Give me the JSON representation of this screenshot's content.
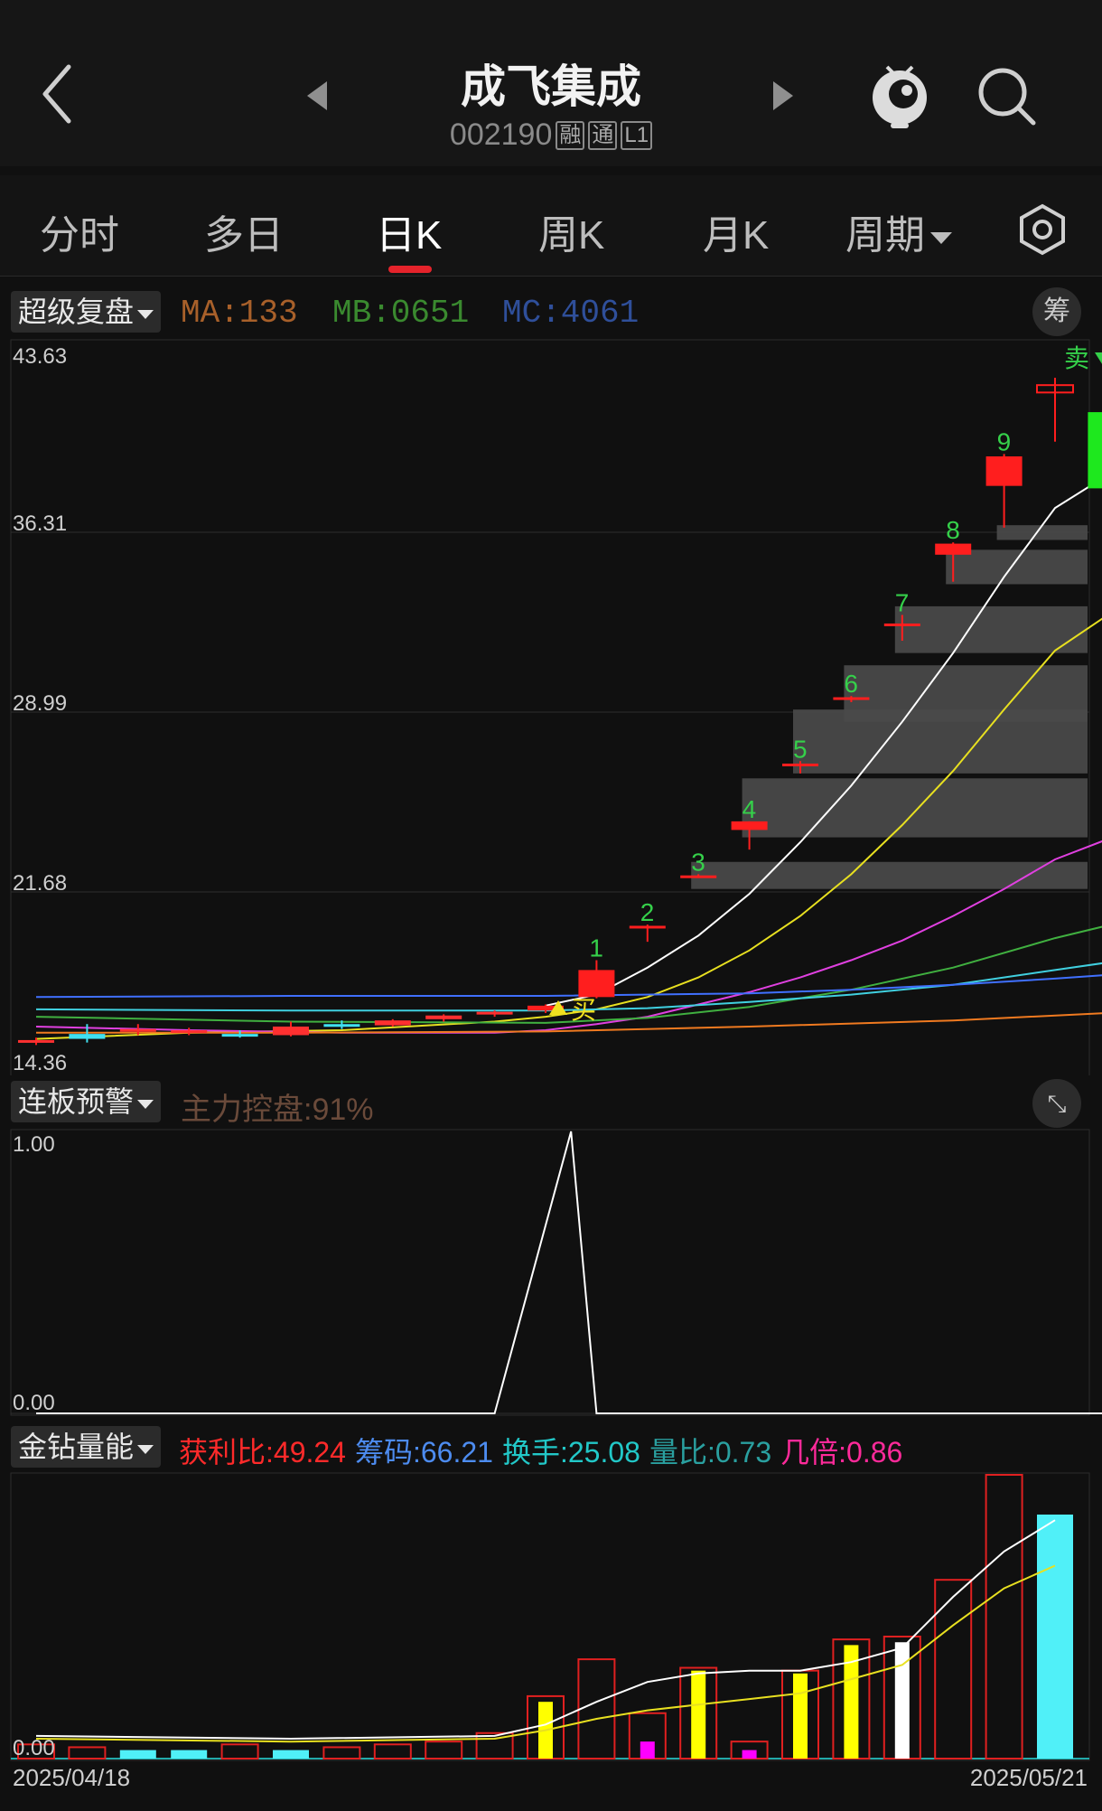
{
  "header": {
    "stock_name": "成飞集成",
    "stock_code": "002190",
    "tag_rong": "融",
    "tag_tong": "通",
    "tag_level": "L1"
  },
  "tabs": [
    "分时",
    "多日",
    "日K",
    "周K",
    "月K",
    "周期"
  ],
  "active_tab": "日K",
  "main_panel": {
    "button": "超级复盘",
    "ma_label": "MA:133",
    "mb_label": "MB:0651",
    "mc_label": "MC:4061",
    "chip_button": "筹",
    "colors": {
      "ma": "#a8602a",
      "mb": "#3a8a2f",
      "mc": "#2f4f9a"
    }
  },
  "lianban_panel": {
    "button": "连板预警",
    "indicator": "主力控盘:91%",
    "y_top": "1.00",
    "y_bottom": "0.00"
  },
  "volume_panel": {
    "button": "金钻量能",
    "stats": [
      {
        "text": "获利比:49.24",
        "color": "#ff2a2a"
      },
      {
        "text": "筹码:66.21",
        "color": "#4d8cf0"
      },
      {
        "text": "换手:25.08",
        "color": "#22c8c8"
      },
      {
        "text": "量比:0.73",
        "color": "#2aa0a0"
      },
      {
        "text": "几倍:0.86",
        "color": "#ff2a9a"
      }
    ],
    "y_bottom": "0.00"
  },
  "chart_data": {
    "type": "candlestick",
    "y_ticks": [
      "43.63",
      "36.31",
      "28.99",
      "21.68",
      "14.36"
    ],
    "ylim": [
      14.36,
      43.63
    ],
    "x_start": "2025/04/18",
    "x_end": "2025/05/21",
    "candles": [
      {
        "o": 15.6,
        "h": 15.75,
        "l": 15.45,
        "c": 15.65
      },
      {
        "o": 15.9,
        "h": 16.3,
        "l": 15.55,
        "c": 15.7
      },
      {
        "o": 16.0,
        "h": 16.3,
        "l": 15.85,
        "c": 16.1
      },
      {
        "o": 15.95,
        "h": 16.15,
        "l": 15.85,
        "c": 16.05
      },
      {
        "o": 15.9,
        "h": 16.05,
        "l": 15.75,
        "c": 15.85
      },
      {
        "o": 15.85,
        "h": 16.4,
        "l": 15.8,
        "c": 16.2
      },
      {
        "o": 16.3,
        "h": 16.45,
        "l": 16.1,
        "c": 16.2
      },
      {
        "o": 16.25,
        "h": 16.5,
        "l": 16.2,
        "c": 16.45
      },
      {
        "o": 16.5,
        "h": 16.7,
        "l": 16.4,
        "c": 16.65
      },
      {
        "o": 16.7,
        "h": 16.85,
        "l": 16.6,
        "c": 16.8
      },
      {
        "o": 16.85,
        "h": 17.1,
        "l": 16.75,
        "c": 17.05
      },
      {
        "o": 17.4,
        "h": 18.9,
        "l": 17.35,
        "c": 18.5
      },
      {
        "o": 20.3,
        "h": 20.35,
        "l": 19.65,
        "c": 20.3
      },
      {
        "o": 22.35,
        "h": 22.4,
        "l": 22.25,
        "c": 22.35
      },
      {
        "o": 24.2,
        "h": 24.55,
        "l": 23.4,
        "c": 24.55
      },
      {
        "o": 26.9,
        "h": 27.0,
        "l": 26.5,
        "c": 26.9
      },
      {
        "o": 29.6,
        "h": 29.65,
        "l": 29.4,
        "c": 29.6
      },
      {
        "o": 32.6,
        "h": 32.95,
        "l": 31.9,
        "c": 32.6
      },
      {
        "o": 35.4,
        "h": 35.9,
        "l": 34.3,
        "c": 35.85
      },
      {
        "o": 38.2,
        "h": 39.5,
        "l": 36.5,
        "c": 39.4
      },
      {
        "o": 42.0,
        "h": 42.6,
        "l": 40.0,
        "c": 42.3
      },
      {
        "o": 41.2,
        "h": 41.55,
        "l": 38.0,
        "c": 38.1
      }
    ],
    "count_labels": [
      {
        "i": 11,
        "t": "1"
      },
      {
        "i": 12,
        "t": "2"
      },
      {
        "i": 13,
        "t": "3"
      },
      {
        "i": 14,
        "t": "4"
      },
      {
        "i": 15,
        "t": "5"
      },
      {
        "i": 16,
        "t": "6"
      },
      {
        "i": 17,
        "t": "7"
      },
      {
        "i": 18,
        "t": "8"
      },
      {
        "i": 19,
        "t": "9"
      }
    ],
    "buy_signal": {
      "i": 10,
      "text": "买"
    },
    "sell_signal": {
      "i": 20,
      "text": "卖"
    },
    "chip_zones": [
      {
        "i": 13,
        "lo": 21.8,
        "hi": 22.9
      },
      {
        "i": 14,
        "lo": 23.9,
        "hi": 26.3
      },
      {
        "i": 15,
        "lo": 26.5,
        "hi": 29.1
      },
      {
        "i": 16,
        "lo": 28.6,
        "hi": 30.9
      },
      {
        "i": 17,
        "lo": 31.4,
        "hi": 33.3
      },
      {
        "i": 18,
        "lo": 34.2,
        "hi": 35.6
      },
      {
        "i": 19,
        "lo": 36.0,
        "hi": 36.6
      }
    ],
    "ma_lines": [
      {
        "color": "#ffffff",
        "pts": [
          [
            10,
            17.05
          ],
          [
            11,
            17.5
          ],
          [
            12,
            18.6
          ],
          [
            13,
            19.9
          ],
          [
            14,
            21.6
          ],
          [
            15,
            23.7
          ],
          [
            16,
            26.0
          ],
          [
            17,
            28.6
          ],
          [
            18,
            31.4
          ],
          [
            19,
            34.5
          ],
          [
            20,
            37.3
          ],
          [
            21,
            38.6
          ]
        ]
      },
      {
        "color": "#e8e020",
        "pts": [
          [
            0,
            15.7
          ],
          [
            3,
            15.95
          ],
          [
            6,
            16.05
          ],
          [
            9,
            16.4
          ],
          [
            10,
            16.6
          ],
          [
            11,
            16.9
          ],
          [
            12,
            17.4
          ],
          [
            13,
            18.2
          ],
          [
            14,
            19.3
          ],
          [
            15,
            20.7
          ],
          [
            16,
            22.4
          ],
          [
            17,
            24.4
          ],
          [
            18,
            26.6
          ],
          [
            19,
            29.1
          ],
          [
            20,
            31.5
          ],
          [
            21,
            32.9
          ]
        ]
      },
      {
        "color": "#e040e0",
        "pts": [
          [
            0,
            16.2
          ],
          [
            3,
            16.05
          ],
          [
            6,
            15.95
          ],
          [
            9,
            15.95
          ],
          [
            10,
            16.05
          ],
          [
            11,
            16.3
          ],
          [
            12,
            16.6
          ],
          [
            13,
            17.1
          ],
          [
            14,
            17.6
          ],
          [
            15,
            18.2
          ],
          [
            16,
            18.9
          ],
          [
            17,
            19.7
          ],
          [
            18,
            20.7
          ],
          [
            19,
            21.8
          ],
          [
            20,
            23.0
          ],
          [
            21,
            23.8
          ]
        ]
      },
      {
        "color": "#40b040",
        "pts": [
          [
            0,
            16.6
          ],
          [
            5,
            16.4
          ],
          [
            10,
            16.35
          ],
          [
            12,
            16.55
          ],
          [
            14,
            17.0
          ],
          [
            16,
            17.7
          ],
          [
            18,
            18.6
          ],
          [
            20,
            19.8
          ],
          [
            21,
            20.3
          ]
        ]
      },
      {
        "color": "#40d0e0",
        "pts": [
          [
            0,
            16.9
          ],
          [
            5,
            16.85
          ],
          [
            10,
            16.85
          ],
          [
            12,
            16.95
          ],
          [
            14,
            17.2
          ],
          [
            16,
            17.5
          ],
          [
            18,
            17.9
          ],
          [
            20,
            18.5
          ],
          [
            21,
            18.8
          ]
        ]
      },
      {
        "color": "#4070ff",
        "pts": [
          [
            0,
            17.4
          ],
          [
            5,
            17.45
          ],
          [
            10,
            17.45
          ],
          [
            14,
            17.55
          ],
          [
            16,
            17.7
          ],
          [
            18,
            17.9
          ],
          [
            20,
            18.15
          ],
          [
            21,
            18.3
          ]
        ]
      },
      {
        "color": "#f07a20",
        "pts": [
          [
            0,
            15.95
          ],
          [
            5,
            15.95
          ],
          [
            10,
            16.0
          ],
          [
            14,
            16.2
          ],
          [
            18,
            16.45
          ],
          [
            21,
            16.75
          ]
        ]
      }
    ],
    "lianban_ylim": [
      0,
      1
    ],
    "lianban_line": [
      [
        0,
        0
      ],
      [
        9,
        0
      ],
      [
        10.5,
        1
      ],
      [
        11,
        0
      ],
      [
        21,
        0
      ]
    ],
    "volume": {
      "ylim": [
        0,
        100
      ],
      "bars": [
        {
          "v": 5,
          "style": "red-outline"
        },
        {
          "v": 4,
          "style": "red-outline"
        },
        {
          "v": 3,
          "style": "cyan"
        },
        {
          "v": 3,
          "style": "cyan"
        },
        {
          "v": 5,
          "style": "red-outline"
        },
        {
          "v": 3,
          "style": "cyan"
        },
        {
          "v": 4,
          "style": "red-outline"
        },
        {
          "v": 5,
          "style": "red-outline"
        },
        {
          "v": 6,
          "style": "red-outline"
        },
        {
          "v": 9,
          "style": "red-outline"
        },
        {
          "v": 22,
          "style": "red-outline",
          "inner": 20,
          "inner_color": "#ffff00"
        },
        {
          "v": 35,
          "style": "red-outline"
        },
        {
          "v": 16,
          "style": "red-outline",
          "inner": 6,
          "inner_color": "#ff00ff"
        },
        {
          "v": 32,
          "style": "red-outline",
          "inner": 31,
          "inner_color": "#ffff00"
        },
        {
          "v": 6,
          "style": "red-outline",
          "inner": 3,
          "inner_color": "#ff00ff"
        },
        {
          "v": 31,
          "style": "red-outline",
          "inner": 30,
          "inner_color": "#ffff00"
        },
        {
          "v": 42,
          "style": "red-outline",
          "inner": 40,
          "inner_color": "#ffff00"
        },
        {
          "v": 43,
          "style": "red-outline",
          "inner": 41,
          "inner_color": "#ffffff"
        },
        {
          "v": 63,
          "style": "red-outline"
        },
        {
          "v": 100,
          "style": "red-outline"
        },
        {
          "v": 86,
          "style": "cyan"
        }
      ],
      "lines": [
        {
          "color": "#ffffff",
          "pts": [
            [
              0,
              8
            ],
            [
              5,
              7
            ],
            [
              9,
              8
            ],
            [
              10,
              12
            ],
            [
              11,
              20
            ],
            [
              12,
              27
            ],
            [
              13,
              30
            ],
            [
              14,
              31
            ],
            [
              15,
              31
            ],
            [
              16,
              34
            ],
            [
              17,
              39
            ],
            [
              18,
              57
            ],
            [
              19,
              73
            ],
            [
              20,
              84
            ]
          ]
        },
        {
          "color": "#e8e020",
          "pts": [
            [
              0,
              7
            ],
            [
              5,
              6
            ],
            [
              9,
              7
            ],
            [
              10,
              10
            ],
            [
              11,
              14
            ],
            [
              12,
              17
            ],
            [
              13,
              19
            ],
            [
              14,
              21
            ],
            [
              15,
              23
            ],
            [
              16,
              28
            ],
            [
              17,
              33
            ],
            [
              18,
              47
            ],
            [
              19,
              60
            ],
            [
              20,
              68
            ]
          ]
        }
      ]
    }
  }
}
